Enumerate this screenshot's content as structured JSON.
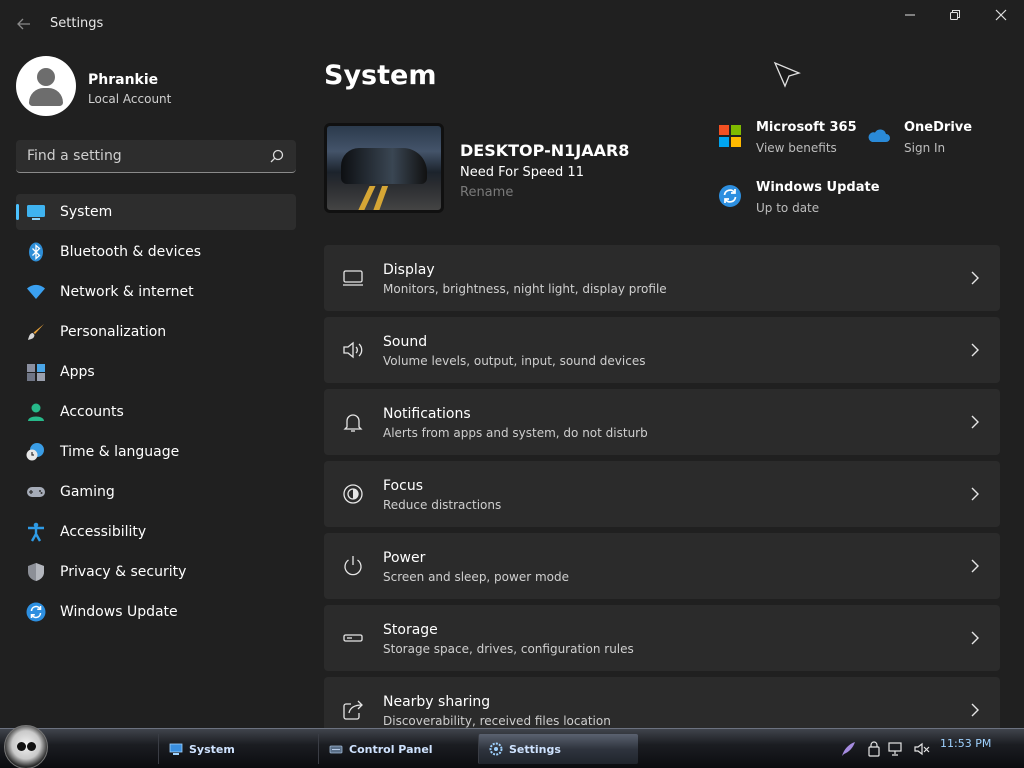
{
  "window": {
    "title": "Settings"
  },
  "profile": {
    "name": "Phrankie",
    "account_type": "Local Account"
  },
  "search": {
    "placeholder": "Find a setting"
  },
  "sidebar": {
    "items": [
      {
        "label": "System",
        "icon": "system-icon",
        "active": true
      },
      {
        "label": "Bluetooth & devices",
        "icon": "bluetooth-icon"
      },
      {
        "label": "Network & internet",
        "icon": "wifi-icon"
      },
      {
        "label": "Personalization",
        "icon": "paintbrush-icon"
      },
      {
        "label": "Apps",
        "icon": "apps-icon"
      },
      {
        "label": "Accounts",
        "icon": "account-icon"
      },
      {
        "label": "Time & language",
        "icon": "globe-clock-icon"
      },
      {
        "label": "Gaming",
        "icon": "gamepad-icon"
      },
      {
        "label": "Accessibility",
        "icon": "accessibility-icon"
      },
      {
        "label": "Privacy & security",
        "icon": "shield-icon"
      },
      {
        "label": "Windows Update",
        "icon": "update-icon"
      }
    ]
  },
  "main": {
    "title": "System",
    "device": {
      "name": "DESKTOP-N1JAAR8",
      "model": "Need For Speed 11",
      "rename": "Rename"
    },
    "quick": [
      {
        "title": "Microsoft 365",
        "sub": "View benefits",
        "icon": "microsoft-logo-icon"
      },
      {
        "title": "OneDrive",
        "sub": "Sign In",
        "icon": "cloud-icon"
      },
      {
        "title": "Windows Update",
        "sub": "Up to date",
        "icon": "update-icon"
      }
    ],
    "cards": [
      {
        "title": "Display",
        "sub": "Monitors, brightness, night light, display profile",
        "icon": "display-icon"
      },
      {
        "title": "Sound",
        "sub": "Volume levels, output, input, sound devices",
        "icon": "speaker-icon"
      },
      {
        "title": "Notifications",
        "sub": "Alerts from apps and system, do not disturb",
        "icon": "bell-icon"
      },
      {
        "title": "Focus",
        "sub": "Reduce distractions",
        "icon": "focus-icon"
      },
      {
        "title": "Power",
        "sub": "Screen and sleep, power mode",
        "icon": "power-icon"
      },
      {
        "title": "Storage",
        "sub": "Storage space, drives, configuration rules",
        "icon": "storage-icon"
      },
      {
        "title": "Nearby sharing",
        "sub": "Discoverability, received files location",
        "icon": "share-icon"
      }
    ]
  },
  "taskbar": {
    "tasks": [
      {
        "label": "System",
        "icon": "monitor-icon"
      },
      {
        "label": "Control Panel",
        "icon": "control-panel-icon"
      },
      {
        "label": "Settings",
        "icon": "gear-icon",
        "active": true
      }
    ],
    "clock": "11:53 PM"
  },
  "colors": {
    "accent": "#4cc2ff",
    "background": "#202020",
    "card": "#2b2b2b"
  }
}
